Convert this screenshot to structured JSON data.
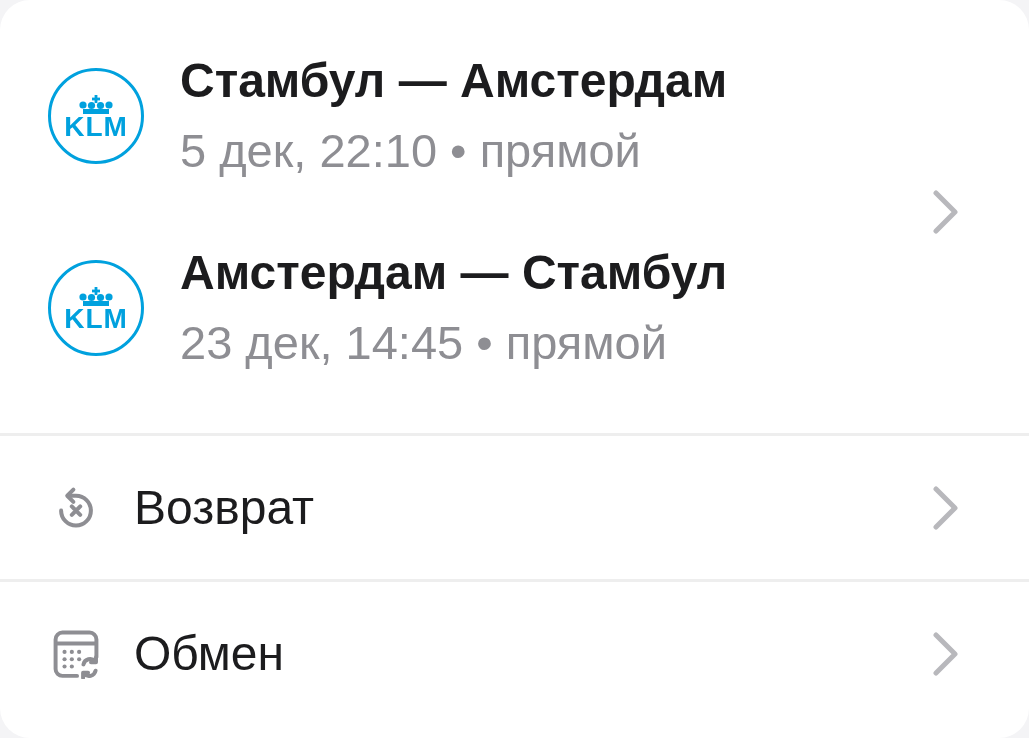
{
  "flights": [
    {
      "airline": "KLM",
      "route": "Стамбул — Амстердам",
      "details": "5 дек, 22:10 • прямой"
    },
    {
      "airline": "KLM",
      "route": "Амстердам — Стамбул",
      "details": "23 дек, 14:45 • прямой"
    }
  ],
  "actions": [
    {
      "kind": "refund",
      "label": "Возврат"
    },
    {
      "kind": "exchange",
      "label": "Обмен"
    }
  ]
}
